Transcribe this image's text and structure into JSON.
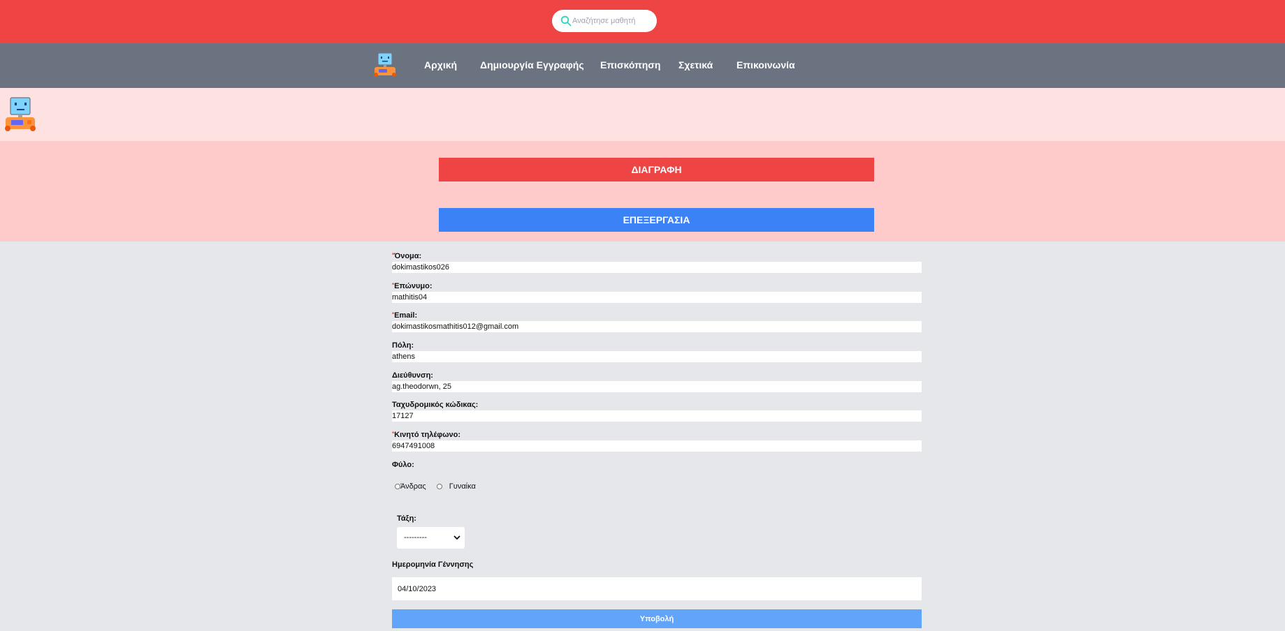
{
  "search": {
    "placeholder": "Αναζήτησε μαθητή",
    "icon": "search-icon",
    "icon_color": "#2dd4bf"
  },
  "nav": {
    "logo": "computer-mascot-logo",
    "items": [
      {
        "label": "Αρχική"
      },
      {
        "label": "Δημιουργία Εγγραφής"
      },
      {
        "label": "Επισκόπηση"
      },
      {
        "label": "Σχετικά"
      },
      {
        "label": "Επικοινωνία"
      }
    ]
  },
  "actions": {
    "delete_label": "ΔΙΑΓΡΑΦΗ",
    "edit_label": "ΕΠΕΞΕΡΓΑΣΙΑ"
  },
  "form": {
    "required_mark": "*",
    "fields": [
      {
        "label": "Όνομα:",
        "required": true,
        "value": "dokimastikos026"
      },
      {
        "label": "Επώνυμο:",
        "required": true,
        "value": "mathitis04"
      },
      {
        "label": "Email:",
        "required": true,
        "value": "dokimastikosmathitis012@gmail.com"
      },
      {
        "label": "Πόλη:",
        "required": false,
        "value": "athens"
      },
      {
        "label": "Διεύθυνση:",
        "required": false,
        "value": "ag.theodorwn, 25"
      },
      {
        "label": "Ταχυδρομικός κώδικας:",
        "required": false,
        "value": "17127"
      },
      {
        "label": "Κινητό τηλέφωνο:",
        "required": true,
        "value": "6947491008"
      }
    ],
    "gender": {
      "label": "Φύλο:",
      "options": [
        "Άνδρας",
        "Γυναίκα"
      ]
    },
    "class": {
      "label": "Τάξη:",
      "selected": "---------"
    },
    "birthdate": {
      "label": "Ημερομηνία Γέννησης",
      "value": "04/10/2023"
    },
    "submit_label": "Υποβολή"
  },
  "colors": {
    "topbar": "#ef4444",
    "nav": "#6b7280",
    "hero": "#fee2e2",
    "actions_bg": "#fecaca",
    "delete": "#ef4444",
    "edit": "#3b82f6",
    "submit": "#60a5fa",
    "form_bg": "#e5e7eb"
  }
}
